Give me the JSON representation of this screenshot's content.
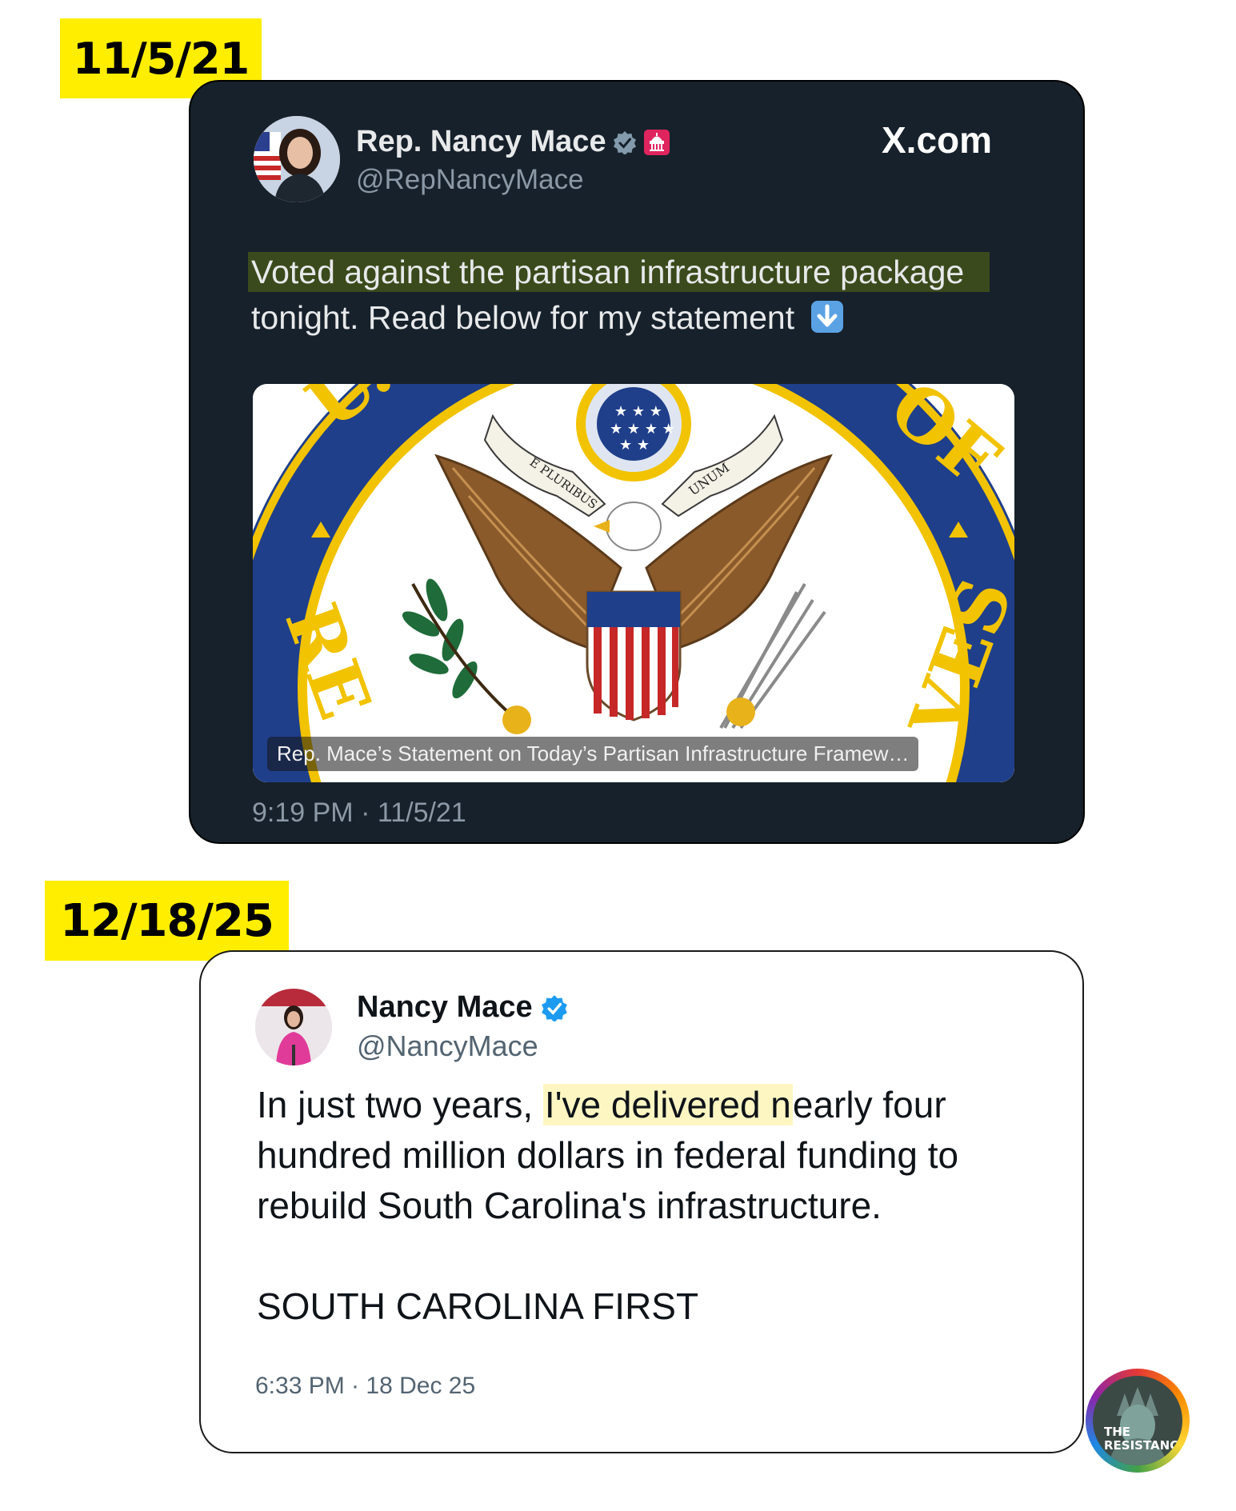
{
  "tweet1": {
    "date_tag": "11/5/21",
    "display_name": "Rep. Nancy Mace",
    "handle": "@RepNancyMace",
    "site_label": "X.com",
    "text_highlighted": "Voted against the partisan infrastructure package",
    "text_rest": "tonight. Read below for my statement",
    "link_card_caption": "Rep. Mace’s Statement on Today’s Partisan Infrastructure Framew…",
    "seal": {
      "ring_left": "U.",
      "ring_right": "OF",
      "ring_bottom_left": "RE",
      "ring_bottom_right": "VES",
      "banner_left": "E PLURIBUS",
      "banner_right": "UNUM"
    },
    "timestamp": "9:19 PM · 11/5/21"
  },
  "tweet2": {
    "date_tag": "12/18/25",
    "display_name": "Nancy Mace",
    "handle": "@NancyMace",
    "text_before": "In just two years, ",
    "text_highlighted": "I've delivered n",
    "text_after": "early four hundred million dollars in federal funding to rebuild South Carolina's infrastructure.",
    "text_second": "SOUTH CAROLINA FIRST",
    "timestamp": "6:33 PM · 18 Dec 25"
  },
  "watermark": {
    "line1": "THE",
    "line2": "RESISTANCE"
  },
  "colors": {
    "date_tag_bg": "#ffee00",
    "dark_card_bg": "#17212b",
    "dark_highlight": "#3b4a1c",
    "light_highlight": "#fdf6c3",
    "verified_blue": "#1d9bf0",
    "seal_blue": "#1f3f8a",
    "seal_gold": "#f2c300"
  }
}
